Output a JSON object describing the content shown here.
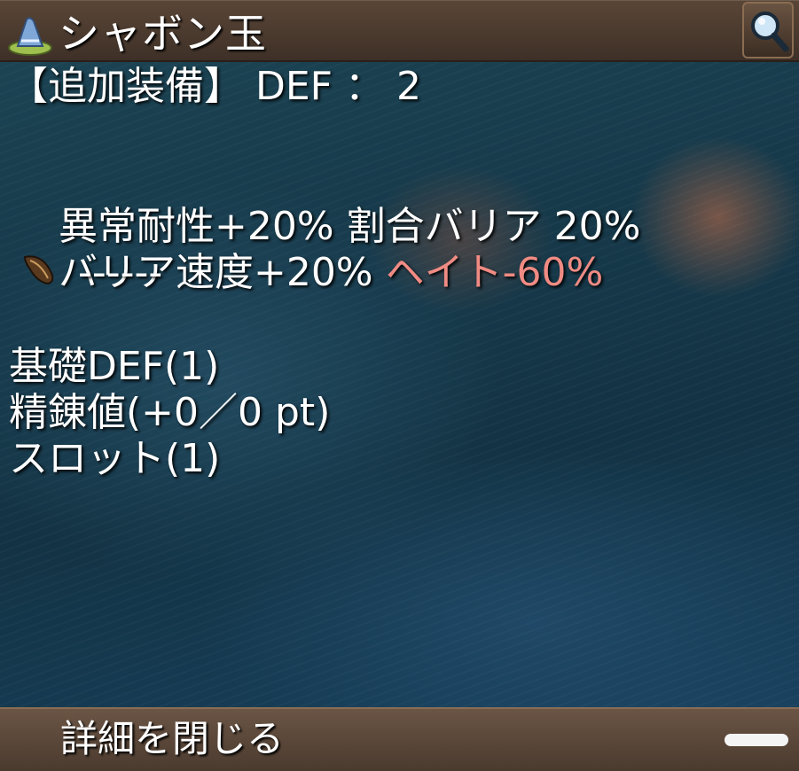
{
  "window": {
    "title": "シャボン玉",
    "title_icon": "wizard-hat-icon",
    "magnifier_icon": "magnifier-icon"
  },
  "stats": {
    "additional_equipment": "【追加装備】 DEF ： 2",
    "line1_a": "異常耐性+20%",
    "line1_b": "割合バリア 20%",
    "line2_a": "バリア速度+20%",
    "line2_b": "ヘイト-60%",
    "card_slot": "------",
    "card_slot_icon": "seed-icon",
    "base_def": "基礎DEF(1)",
    "refine": "精錬値(+0／0 pt)",
    "slots": "スロット(1)"
  },
  "footer": {
    "close_details": "詳細を閉じる"
  },
  "colors": {
    "highlight_red": "#f08b84",
    "frame_brown": "#4a3a2e"
  }
}
